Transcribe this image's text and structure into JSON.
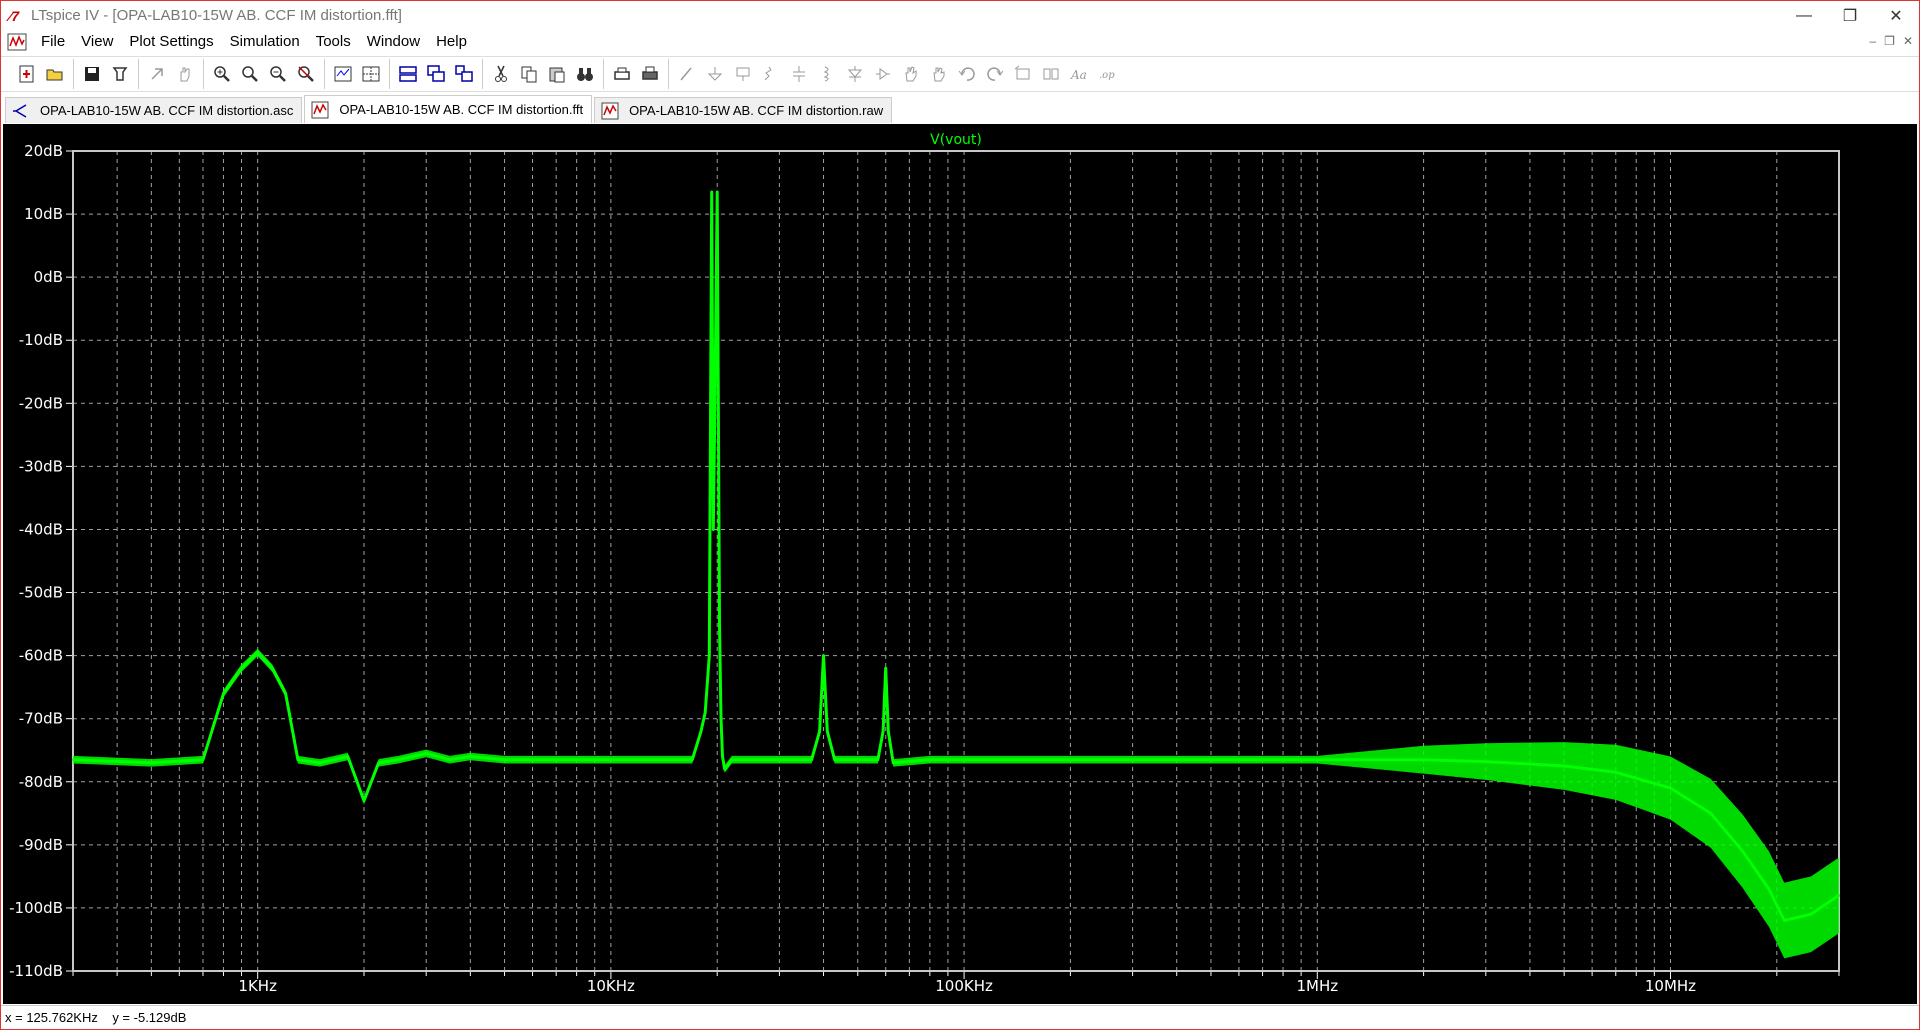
{
  "window": {
    "title": "LTspice IV - [OPA-LAB10-15W AB. CCF IM distortion.fft]",
    "minimize_glyph": "—",
    "restore_glyph": "❐",
    "close_glyph": "✕"
  },
  "menu": {
    "items": [
      "File",
      "View",
      "Plot Settings",
      "Simulation",
      "Tools",
      "Window",
      "Help"
    ]
  },
  "tabs": [
    {
      "label": "OPA-LAB10-15W AB. CCF IM distortion.asc",
      "icon": "schematic-icon",
      "active": false
    },
    {
      "label": "OPA-LAB10-15W AB. CCF IM distortion.fft",
      "icon": "waveform-icon",
      "active": true
    },
    {
      "label": "OPA-LAB10-15W AB. CCF IM distortion.raw",
      "icon": "waveform-icon",
      "active": false
    }
  ],
  "status": {
    "text": "x = 125.762KHz    y = -5.129dB"
  },
  "colors": {
    "trace": "#00ff00",
    "grid": "#a0a0a0",
    "axis_text": "#ffffff",
    "background": "#000000",
    "title": "#00ff00"
  },
  "chart_data": {
    "type": "line",
    "title": "V(vout)",
    "xscale": "log",
    "xlim": [
      300,
      30000000
    ],
    "ylim": [
      -110,
      20
    ],
    "yticks": [
      20,
      10,
      0,
      -10,
      -20,
      -30,
      -40,
      -50,
      -60,
      -70,
      -80,
      -90,
      -100,
      -110
    ],
    "ytick_labels": [
      "20dB",
      "10dB",
      "0dB",
      "-10dB",
      "-20dB",
      "-30dB",
      "-40dB",
      "-50dB",
      "-60dB",
      "-70dB",
      "-80dB",
      "-90dB",
      "-100dB",
      "-110dB"
    ],
    "xticks": [
      1000,
      10000,
      100000,
      1000000,
      10000000
    ],
    "xtick_labels": [
      "1KHz",
      "10KHz",
      "100KHz",
      "1MHz",
      "10MHz"
    ],
    "grid": true,
    "series": [
      {
        "name": "V(vout)",
        "x": [
          300,
          500,
          700,
          800,
          900,
          1000,
          1100,
          1200,
          1300,
          1500,
          1800,
          2000,
          2200,
          2500,
          3000,
          3500,
          4000,
          5000,
          6000,
          8000,
          10000,
          13000,
          15000,
          17000,
          18000,
          18500,
          19000,
          19300,
          19500,
          19700,
          20000,
          20300,
          20500,
          20700,
          21000,
          22000,
          25000,
          30000,
          37000,
          39000,
          40000,
          41000,
          43000,
          50000,
          57000,
          59000,
          60000,
          61000,
          63000,
          80000,
          100000,
          200000,
          500000,
          1000000,
          2000000,
          3000000,
          5000000,
          7000000,
          10000000,
          13000000,
          16000000,
          19000000,
          21000000,
          25000000,
          30000000
        ],
        "y": [
          -76.5,
          -77,
          -76.5,
          -66,
          -62,
          -59.5,
          -62,
          -66,
          -76.5,
          -77,
          -76,
          -83,
          -77,
          -76.5,
          -75.5,
          -76.5,
          -76,
          -76.5,
          -76.5,
          -76.5,
          -76.5,
          -76.5,
          -76.5,
          -76.5,
          -72,
          -69,
          -60,
          13.5,
          -40,
          -20,
          13.5,
          -55,
          -70,
          -76,
          -78,
          -76.5,
          -76.5,
          -76.5,
          -76.5,
          -72,
          -60,
          -72,
          -76.5,
          -76.5,
          -76.5,
          -72,
          -62,
          -72,
          -77,
          -76.5,
          -76.5,
          -76.5,
          -76.5,
          -76.5,
          -76.5,
          -76.8,
          -77.5,
          -78.5,
          -81,
          -85,
          -91,
          -97,
          -102,
          -101,
          -98
        ]
      }
    ]
  }
}
